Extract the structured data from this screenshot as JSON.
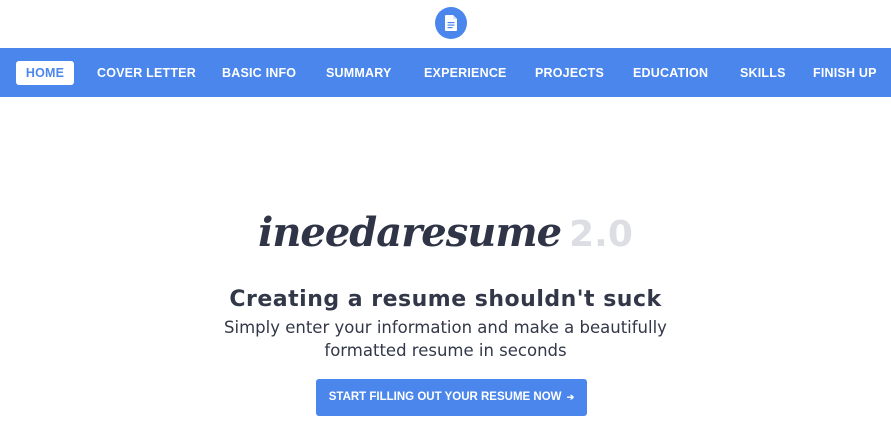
{
  "header": {
    "logo_icon": "document-icon",
    "accent_color": "#4a86ec"
  },
  "nav": {
    "items": [
      {
        "label": "HOME",
        "active": true
      },
      {
        "label": "COVER LETTER",
        "active": false
      },
      {
        "label": "BASIC INFO",
        "active": false
      },
      {
        "label": "SUMMARY",
        "active": false
      },
      {
        "label": "EXPERIENCE",
        "active": false
      },
      {
        "label": "PROJECTS",
        "active": false
      },
      {
        "label": "EDUCATION",
        "active": false
      },
      {
        "label": "SKILLS",
        "active": false
      },
      {
        "label": "FINISH UP",
        "active": false
      }
    ]
  },
  "hero": {
    "brand_name": "ineedaresume",
    "brand_version": "2.0",
    "headline": "Creating a resume shouldn't suck",
    "subline": "Simply enter your information and make a beautifully formatted resume in seconds",
    "cta_label": "START FILLING OUT YOUR RESUME NOW",
    "cta_arrow": "➔"
  }
}
